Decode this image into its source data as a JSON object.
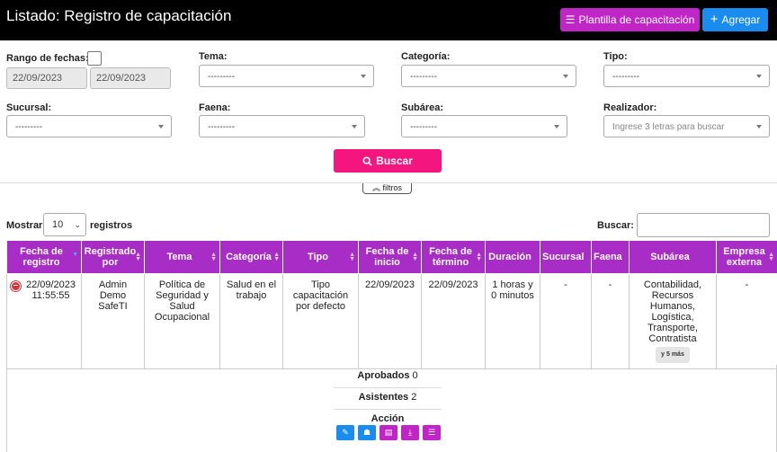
{
  "header": {
    "title": "Listado: Registro de capacitación",
    "template_button": "Plantilla de capacitación",
    "add_button": "Agregar"
  },
  "filters": {
    "date_range_label": "Rango de fechas:",
    "date_from": "22/09/2023",
    "date_to": "22/09/2023",
    "tema_label": "Tema:",
    "tema_value": "---------",
    "categoria_label": "Categoría:",
    "categoria_value": "---------",
    "tipo_label": "Tipo:",
    "tipo_value": "---------",
    "sucursal_label": "Sucursal:",
    "sucursal_value": "---------",
    "faena_label": "Faena:",
    "faena_value": "---------",
    "subarea_label": "Subárea:",
    "subarea_value": "---------",
    "realizador_label": "Realizador:",
    "realizador_placeholder": "Ingrese 3 letras para buscar",
    "search_button": "Buscar",
    "toggle_label": "filtros"
  },
  "list_controls": {
    "show_label": "Mostrar",
    "page_size": "10",
    "records_label": "registros",
    "search_label": "Buscar:"
  },
  "table": {
    "columns": [
      "Fecha de registro",
      "Registrado por",
      "Tema",
      "Categoría",
      "Tipo",
      "Fecha de inicio",
      "Fecha de término",
      "Duración",
      "Sucursal",
      "Faena",
      "Subárea",
      "Empresa externa"
    ],
    "row": {
      "fecha_registro": "22/09/2023 11:55:55",
      "registrado_por": "Admin Demo SafeTI",
      "tema": "Política de Seguridad y Salud Ocupacional",
      "categoria": "Salud en el trabajo",
      "tipo": "Tipo capacitación por defecto",
      "fecha_inicio": "22/09/2023",
      "fecha_termino": "22/09/2023",
      "duracion": "1 horas y 0 minutos",
      "sucursal": "-",
      "faena": "-",
      "subarea": "Contabilidad, Recursos Humanos, Logística, Transporte, Contratista",
      "subarea_more": "y 5 más",
      "empresa_externa": "-"
    }
  },
  "detail": {
    "aprobados_label": "Aprobados",
    "aprobados_value": "0",
    "asistentes_label": "Asistentes",
    "asistentes_value": "2",
    "accion_label": "Acción"
  },
  "colors": {
    "accent_purple": "#a82cc6",
    "template_button": "#c026c6",
    "add_button": "#1a8cf0",
    "search_button": "#f4157f",
    "edit_action": "#1a8cf0"
  }
}
